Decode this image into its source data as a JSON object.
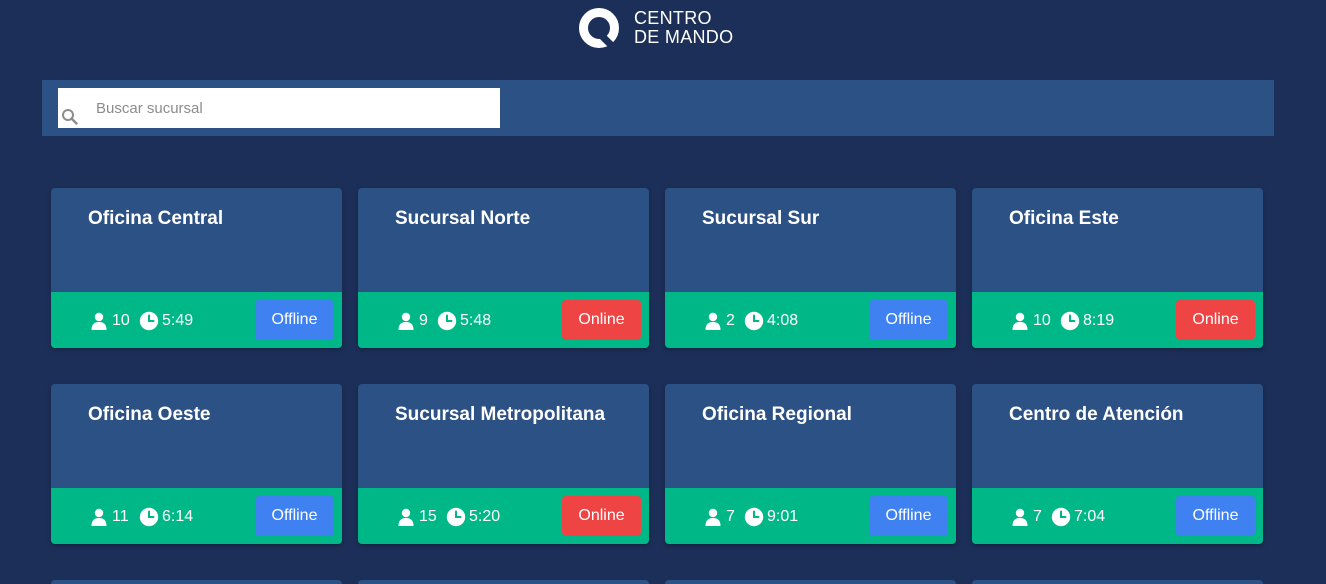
{
  "brand": {
    "line1": "CENTRO",
    "line2": "DE MANDO"
  },
  "search": {
    "placeholder": "Buscar sucursal",
    "value": ""
  },
  "branches": [
    {
      "name": "Oficina Central",
      "users": "10",
      "time": "5:49",
      "status": "Offline"
    },
    {
      "name": "Sucursal Norte",
      "users": "9",
      "time": "5:48",
      "status": "Online"
    },
    {
      "name": "Sucursal Sur",
      "users": "2",
      "time": "4:08",
      "status": "Offline"
    },
    {
      "name": "Oficina Este",
      "users": "10",
      "time": "8:19",
      "status": "Online"
    },
    {
      "name": "Oficina Oeste",
      "users": "11",
      "time": "6:14",
      "status": "Offline"
    },
    {
      "name": "Sucursal Metropolitana",
      "users": "15",
      "time": "5:20",
      "status": "Online"
    },
    {
      "name": "Oficina Regional",
      "users": "7",
      "time": "9:01",
      "status": "Offline"
    },
    {
      "name": "Centro de Atención",
      "users": "7",
      "time": "7:04",
      "status": "Offline"
    }
  ],
  "icons": {
    "users": "user-icon",
    "time": "clock-icon",
    "search": "search-icon",
    "logo": "logo-icon"
  },
  "colors": {
    "background": "#1c2f58",
    "panel": "#2c5185",
    "footer": "#00b887",
    "offline": "#3f81f0",
    "online": "#ee4444"
  }
}
